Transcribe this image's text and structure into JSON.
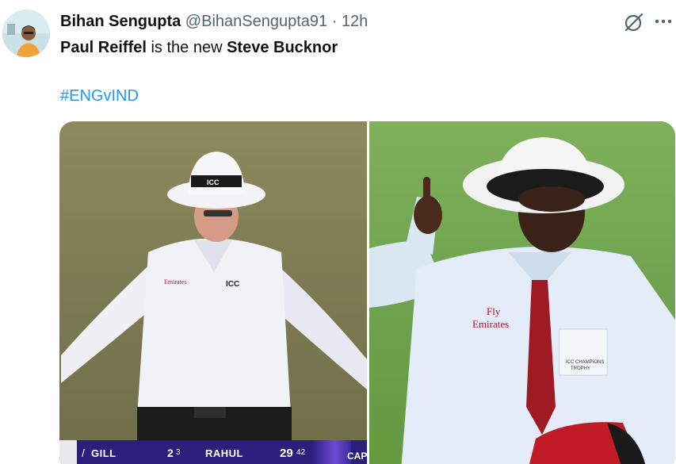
{
  "author": {
    "name": "Bihan Sengupta",
    "handle": "@BihanSengupta91",
    "separator": "·",
    "time": "12h"
  },
  "tweet": {
    "text_parts": [
      "Paul Reiffel",
      " is the new ",
      "Steve Bucknor"
    ],
    "hashtag": "#ENGvIND"
  },
  "icons": {
    "avatar": "avatar-photo",
    "grok": "grok-icon",
    "more": "more-options-icon"
  },
  "media": {
    "left_image": {
      "cap_logo": "ICC",
      "shirt_sponsor": "Emirates",
      "shirt_logo": "ICC",
      "scorebar": {
        "batter1": "GILL",
        "batter1_runs": "2",
        "batter1_balls": "3",
        "batter2": "RAHUL",
        "batter2_runs": "29",
        "batter2_balls": "42",
        "overflow": "CAP"
      }
    },
    "right_image": {
      "shirt_sponsor_line1": "Fly",
      "shirt_sponsor_line2": "Emirates",
      "badge_line1": "ICC CHAMPIONS",
      "badge_line2": "TROPHY"
    }
  },
  "colors": {
    "hashtag": "#1d9bf0",
    "secondary_text": "#536471",
    "scorebar_bg": "#2a1f7a"
  }
}
